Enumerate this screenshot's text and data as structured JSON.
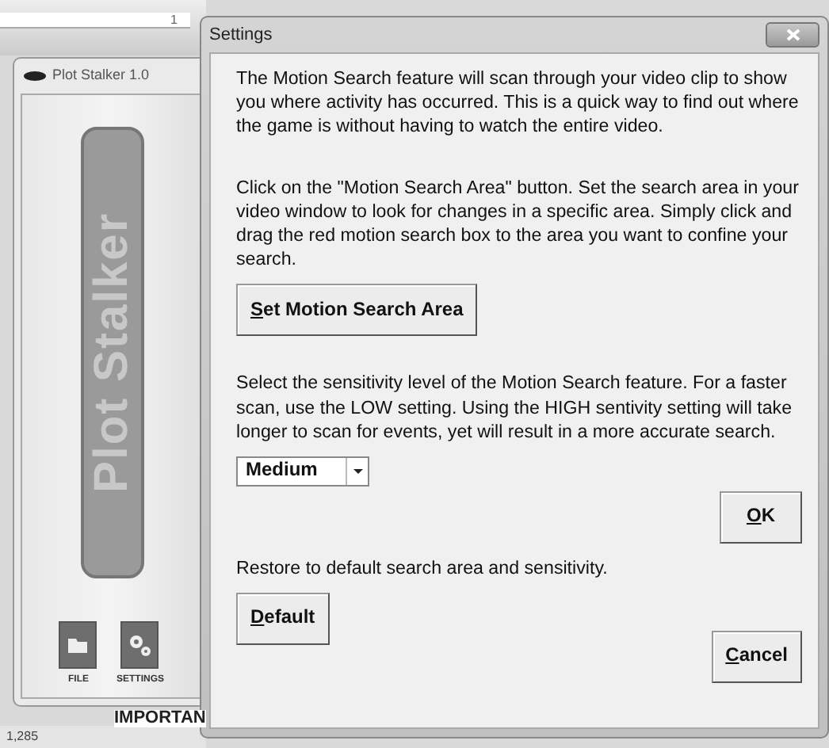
{
  "background": {
    "ruler_mark": "1",
    "status_text": "1,285",
    "document_text": "IMPORTAN"
  },
  "main_window": {
    "title": "Plot Stalker 1.0",
    "logo": "Plot Stalker",
    "buttons": [
      {
        "label": "FILE",
        "kind": "folder"
      },
      {
        "label": "SETTINGS",
        "kind": "gears"
      }
    ]
  },
  "dialog": {
    "title": "Settings",
    "intro": "The Motion Search feature will scan through your video clip to show you where activity has occurred. This is a quick way to find out where the game is without having to watch the entire video.",
    "area_instructions": "Click on the \"Motion Search Area\" button. Set the search area in your video window to look for changes in a specific area. Simply click and drag the red motion search box to the area you want to confine your search.",
    "area_button": {
      "label": "Set Motion Search Area",
      "mnemonic": true
    },
    "sensitivity_instructions": "Select the sensitivity level of the Motion Search feature. For a faster scan, use the LOW setting. Using the HIGH sentivity setting will take longer to scan for events, yet will result in a more accurate search.",
    "sensitivity": {
      "value": "Medium"
    },
    "ok_button": {
      "label": "OK",
      "mnemonic": true
    },
    "restore_text": "Restore to default search area and sensitivity.",
    "default_button": {
      "label": "Default",
      "mnemonic": true
    },
    "cancel_button": {
      "label": "Cancel",
      "mnemonic": true
    }
  }
}
